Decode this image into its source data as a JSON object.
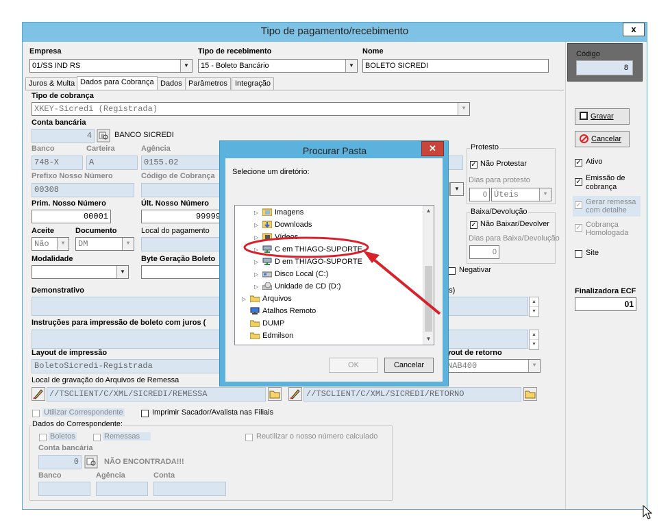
{
  "window": {
    "title": "Tipo de pagamento/recebimento",
    "close": "x"
  },
  "header": {
    "empresa_label": "Empresa",
    "empresa_value": "01/SS IND RS",
    "tipo_label": "Tipo de recebimento",
    "tipo_value": "15 - Boleto Bancário",
    "nome_label": "Nome",
    "nome_value": "BOLETO SICREDI"
  },
  "tabs": [
    "Juros & Multa",
    "Dados para Cobrança",
    "Dados",
    "Parâmetros",
    "Integração"
  ],
  "form": {
    "tipo_cobranca_label": "Tipo de cobrança",
    "tipo_cobranca_value": "XKEY-Sicredi (Registrada)",
    "conta_bancaria_label": "Conta bancária",
    "conta_bancaria_value": "4",
    "conta_bancaria_nome": "BANCO SICREDI",
    "banco_label": "Banco",
    "banco_value": "748-X",
    "carteira_label": "Carteira",
    "carteira_value": "A",
    "agencia_label": "Agência",
    "agencia_value": "0155.02",
    "prefixo_label": "Prefixo Nosso Número",
    "prefixo_value": "00308",
    "codigo_cobranca_label": "Código de Cobrança",
    "prim_label": "Prim. Nosso Número",
    "prim_value": "00001",
    "ult_label": "Últ. Nosso Número",
    "ult_value": "99999",
    "aceite_label": "Aceite",
    "aceite_value": "Não",
    "documento_label": "Documento",
    "documento_value": "DM",
    "local_pagamento_label": "Local do pagamento",
    "modalidade_label": "Modalidade",
    "byte_label": "Byte Geração Boleto",
    "negativar_label": "Negativar",
    "demonstrativo_label": "Demonstrativo",
    "demonstrativo_suffix": "es)",
    "instrucoes_label": "Instruções para impressão de boleto com juros (",
    "layout_impressao_label": "Layout de impressão",
    "layout_impressao_value": "BoletoSicredi-Registrada",
    "layout_retorno_label": "yout de retorno",
    "layout_retorno_value": "NAB400",
    "local_gravacao_label": "Local de gravação do Arquivos de Remessa",
    "remessa_path": "//TSCLIENT/C/XML/SICREDI/REMESSA",
    "retorno_path": "//TSCLIENT/C/XML/SICREDI/RETORNO",
    "utilizar_label": "Utilizar Correspondente",
    "imprimir_label": "Imprimir Sacador/Avalista nas Filiais",
    "dados_corresp_label": "Dados do Correspondente:",
    "boletos_label": "Boletos",
    "remessas_label": "Remessas",
    "reutilizar_label": "Reutilizar o nosso número calculado",
    "corresp_conta_label": "Conta bancária",
    "corresp_conta_value": "0",
    "corresp_nao_encontrada": "NÃO ENCONTRADA!!!",
    "corresp_banco_label": "Banco",
    "corresp_agencia_label": "Agência",
    "corresp_conta2_label": "Conta"
  },
  "protesto": {
    "group_label": "Protesto",
    "nao_protestar": "Não Protestar",
    "dias_label": "Dias para protesto",
    "dias_value": "0",
    "tipo_dias": "Úteis"
  },
  "baixa": {
    "group_label": "Baixa/Devolução",
    "nao_baixar": "Não Baixar/Devolver",
    "dias_label": "Dias para Baixa/Devolução",
    "dias_value": "0"
  },
  "right_panel": {
    "codigo_label": "Código",
    "codigo_value": "8",
    "gravar": "Gravar",
    "cancelar": "Cancelar",
    "ativo": "Ativo",
    "emissao": "Emissão de cobrança",
    "gerar": "Gerar remessa com detalhe",
    "cobranca_homologada": "Cobrança Homologada",
    "site": "Site",
    "finalizadora_label": "Finalizadora ECF",
    "finalizadora_value": "01"
  },
  "dialog": {
    "title": "Procurar Pasta",
    "prompt": "Selecione um diretório:",
    "tree": [
      "Imagens",
      "Downloads",
      "Vídeos",
      "C em THIAGO-SUPORTE",
      "D em THIAGO-SUPORTE",
      "Disco Local (C:)",
      "Unidade de CD (D:)",
      "Arquivos",
      "Atalhos Remoto",
      "DUMP",
      "Edmilson"
    ],
    "ok": "OK",
    "cancel": "Cancelar"
  },
  "colors": {
    "title_bar": "#7ec3e6",
    "dialog_frame": "#5ab2dd",
    "dialog_close": "#c9443a",
    "readonly_field": "#d9e6f2",
    "annotation": "#d8222b"
  }
}
